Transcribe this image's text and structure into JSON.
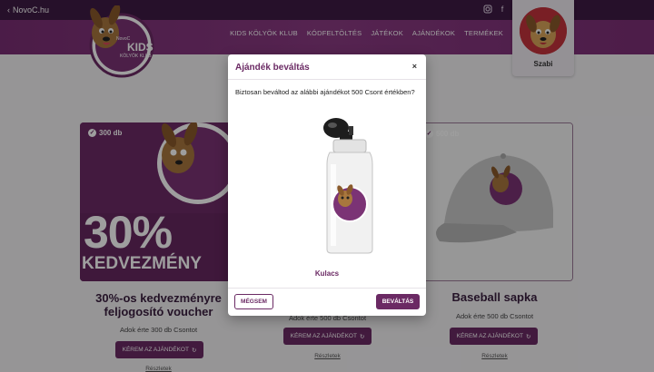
{
  "topbar": {
    "back_label": "NovoC.hu",
    "social_icons": [
      "instagram-icon",
      "facebook-icon"
    ]
  },
  "nav": {
    "items": [
      "KIDS KÖLYÖK KLUB",
      "KÓDFELTÖLTÉS",
      "JÁTÉKOK",
      "AJÁNDÉKOK",
      "TERMÉKEK"
    ]
  },
  "profile": {
    "name": "Szabi"
  },
  "cards": [
    {
      "badge": "300 db",
      "title_line1": "30%-os kedvezményre",
      "title_line2": "feljogosító voucher",
      "subtitle": "Adok érte 300 db Csontot",
      "button": "KÉREM AZ AJÁNDÉKOT",
      "details": "Részletek",
      "promo_big": "30%",
      "promo_small": "KEDVEZMÉNY"
    },
    {
      "subtitle": "Adok érte 500 db Csontot",
      "button": "KÉREM AZ AJÁNDÉKOT",
      "details": "Részletek"
    },
    {
      "badge": "500 db",
      "title_line1": "Baseball sapka",
      "subtitle": "Adok érte 500 db Csontot",
      "button": "KÉREM AZ AJÁNDÉKOT",
      "details": "Részletek"
    }
  ],
  "logo": {
    "line1": "KIDS",
    "line2": "KÖLYÖK KLUB",
    "brand": "NovoC"
  },
  "modal": {
    "title": "Ajándék beváltás",
    "close": "×",
    "message": "Biztosan beváltod az alábbi ajándékot 500 Csont értékben?",
    "item_name": "Kulacs",
    "cancel_label": "MÉGSEM",
    "redeem_label": "BEVÁLTÁS"
  },
  "colors": {
    "brand_purple": "#6b2a64",
    "header_dark": "#3e1a44",
    "accent_red": "#c4323c"
  }
}
